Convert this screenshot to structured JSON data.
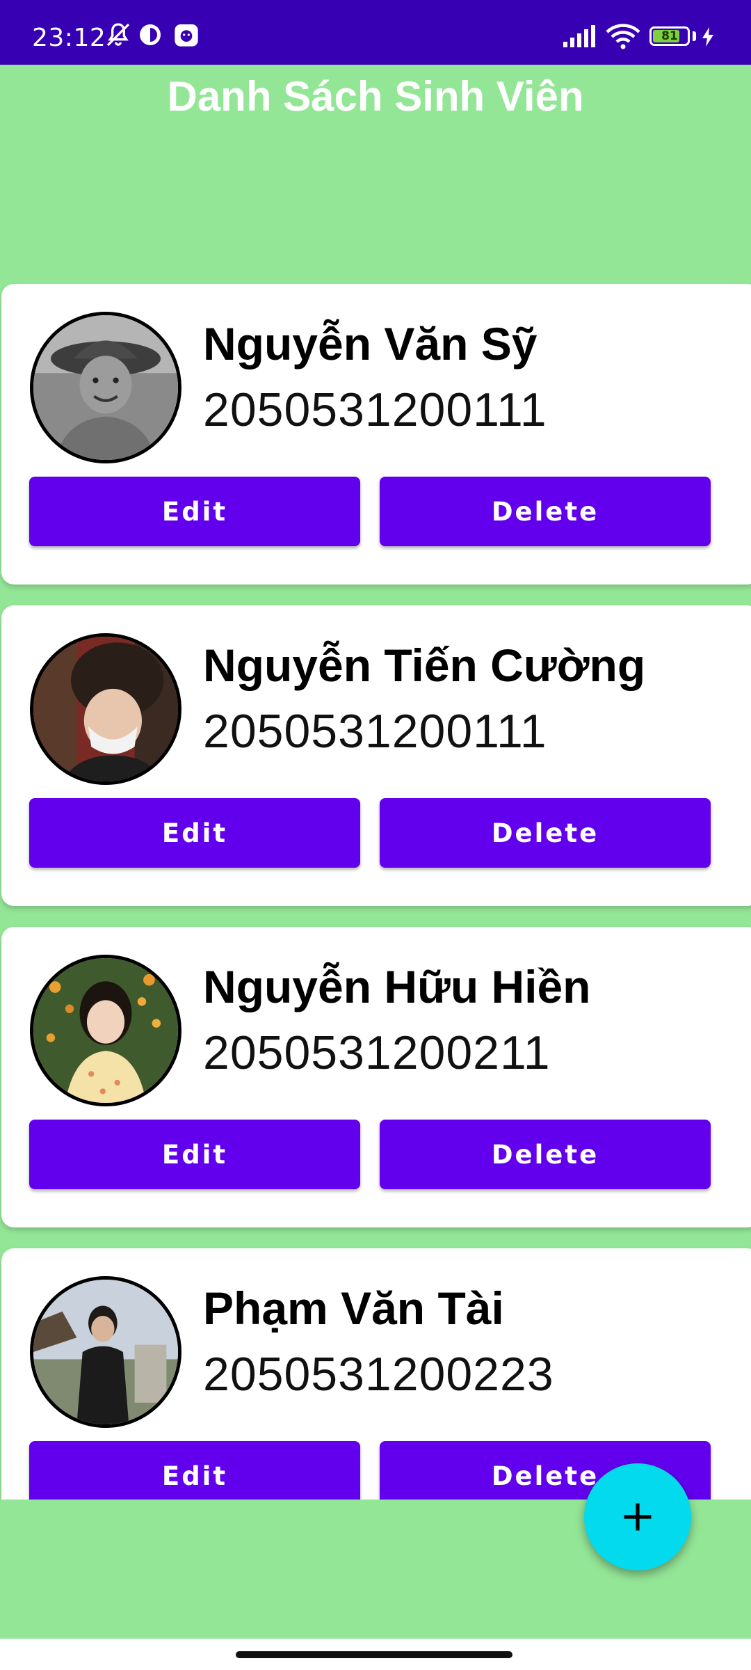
{
  "status_bar": {
    "time": "23:12",
    "battery_level": "81",
    "battery_fraction": 0.81,
    "icons": [
      "bell-off-icon",
      "half-circle-icon",
      "app-notification-icon",
      "signal-icon",
      "wifi-icon",
      "battery-icon",
      "charging-bolt-icon"
    ]
  },
  "page": {
    "title": "Danh Sách Sinh Viên",
    "background_color": "#94E697",
    "accent_color": "#6200EE",
    "fab_color": "#03DAEE"
  },
  "students": [
    {
      "name": "Nguyễn Văn Sỹ",
      "id": "2050531200111",
      "edit_label": "Edit",
      "delete_label": "Delete"
    },
    {
      "name": "Nguyễn Tiến Cường",
      "id": "2050531200111",
      "edit_label": "Edit",
      "delete_label": "Delete"
    },
    {
      "name": "Nguyễn Hữu Hiền",
      "id": "2050531200211",
      "edit_label": "Edit",
      "delete_label": "Delete"
    },
    {
      "name": "Phạm Văn Tài",
      "id": "2050531200223",
      "edit_label": "Edit",
      "delete_label": "Delete"
    }
  ],
  "fab": {
    "icon": "plus-icon"
  }
}
